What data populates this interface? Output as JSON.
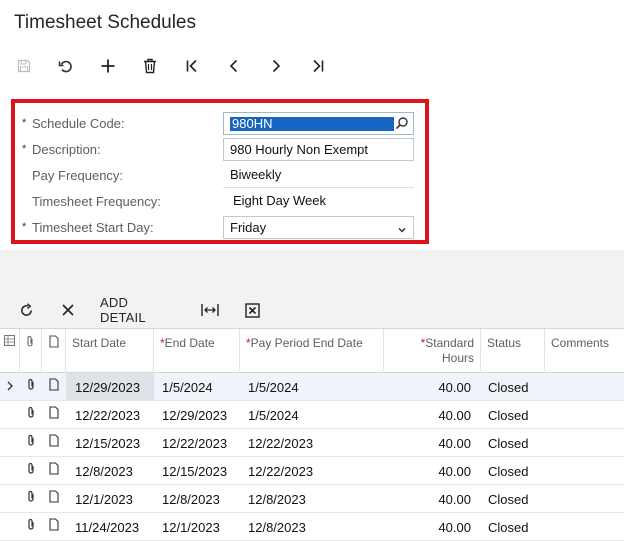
{
  "page": {
    "title": "Timesheet Schedules"
  },
  "form": {
    "schedule_code": {
      "label": "Schedule Code:",
      "value": "980HN",
      "required": true
    },
    "description": {
      "label": "Description:",
      "value": "980 Hourly Non Exempt",
      "required": true
    },
    "pay_frequency": {
      "label": "Pay Frequency:",
      "value": "Biweekly",
      "required": false
    },
    "timesheet_frequency": {
      "label": "Timesheet Frequency:",
      "value": "Eight Day Week",
      "required": false
    },
    "timesheet_start_day": {
      "label": "Timesheet Start Day:",
      "value": "Friday",
      "required": true
    },
    "required_mark": "*"
  },
  "grid_toolbar": {
    "add_detail_label": "ADD DETAIL"
  },
  "grid": {
    "columns": {
      "start_date": "Start Date",
      "end_date": "End Date",
      "pay_period_end_date": "Pay Period End Date",
      "standard_hours_1": "Standard",
      "standard_hours_2": "Hours",
      "status": "Status",
      "comments": "Comments",
      "required_mark": "*"
    },
    "rows": [
      {
        "start": "12/29/2023",
        "end": "1/5/2024",
        "pay_end": "1/5/2024",
        "hours": "40.00",
        "status": "Closed"
      },
      {
        "start": "12/22/2023",
        "end": "12/29/2023",
        "pay_end": "1/5/2024",
        "hours": "40.00",
        "status": "Closed"
      },
      {
        "start": "12/15/2023",
        "end": "12/22/2023",
        "pay_end": "12/22/2023",
        "hours": "40.00",
        "status": "Closed"
      },
      {
        "start": "12/8/2023",
        "end": "12/15/2023",
        "pay_end": "12/22/2023",
        "hours": "40.00",
        "status": "Closed"
      },
      {
        "start": "12/1/2023",
        "end": "12/8/2023",
        "pay_end": "12/8/2023",
        "hours": "40.00",
        "status": "Closed"
      },
      {
        "start": "11/24/2023",
        "end": "12/1/2023",
        "pay_end": "12/8/2023",
        "hours": "40.00",
        "status": "Closed"
      }
    ]
  },
  "colors": {
    "highlight_border": "#d9141b",
    "selection": "#1565c0",
    "required_star": "#d9141b"
  },
  "icons": [
    "save-icon",
    "undo-icon",
    "plus-icon",
    "trash-icon",
    "first-icon",
    "prev-icon",
    "next-icon",
    "last-icon",
    "search-icon",
    "chevron-down-icon",
    "refresh-icon",
    "close-icon",
    "fit-width-icon",
    "excel-icon",
    "paperclip-icon",
    "document-icon",
    "row-selector-icon"
  ]
}
